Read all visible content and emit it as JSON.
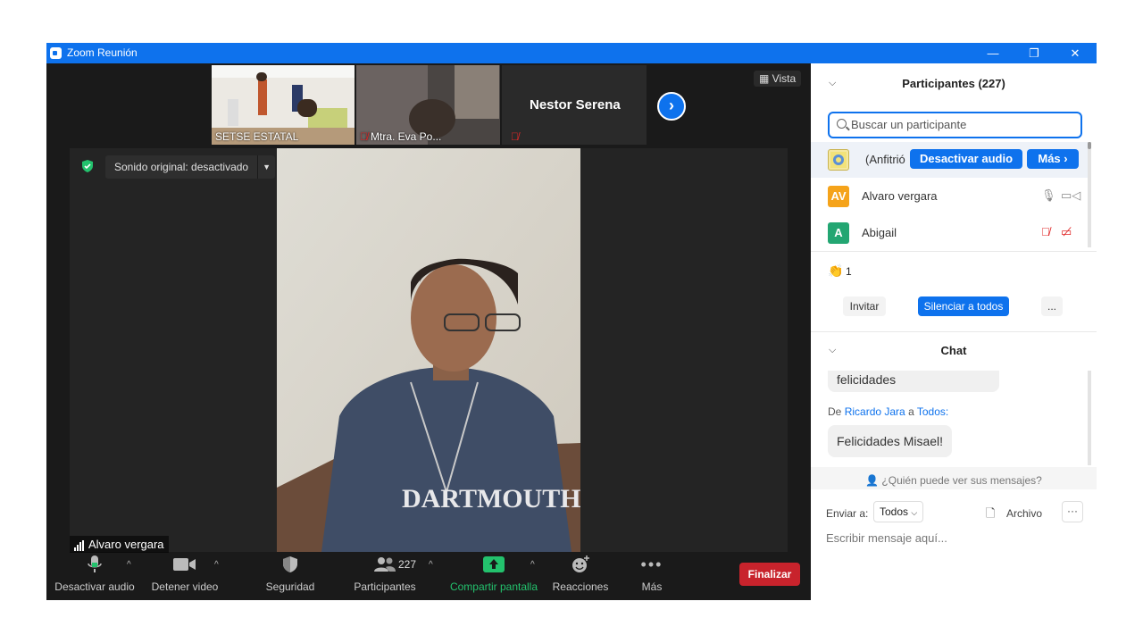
{
  "window": {
    "title": "Zoom Reunión",
    "controls": [
      "—",
      "❐",
      "✕"
    ]
  },
  "thumbnails": [
    {
      "name": "SETSE ESTATAL",
      "muted": false
    },
    {
      "name": "Mtra. Eva Po...",
      "muted": true
    },
    {
      "name": "",
      "muted": true
    },
    {
      "name": "Nestor Serena",
      "muted": false
    }
  ],
  "view_button": "Vista",
  "sound_option": "Sonido original: desactivado",
  "active_speaker": "Alvaro vergara",
  "toolbar": {
    "mute": "Desactivar audio",
    "stop_video": "Detener video",
    "security": "Seguridad",
    "participants": "Participantes",
    "participants_count": "227",
    "share": "Compartir pantalla",
    "reactions": "Reacciones",
    "more": "Más",
    "end": "Finalizar"
  },
  "panel": {
    "participants_title": "Participantes (227)",
    "search_placeholder": "Buscar un participante",
    "host_label": "(Anfitrió",
    "host_mute_btn": "Desactivar audio",
    "host_more_btn": "Más",
    "participants": [
      {
        "initials": "AV",
        "name": "Alvaro vergara",
        "color": "#f5a31a",
        "muted": false,
        "video_off": false
      },
      {
        "initials": "A",
        "name": "Abigail",
        "color": "#23a672",
        "muted": true,
        "video_off": true
      }
    ],
    "raised_hands": "1",
    "invite": "Invitar",
    "mute_all": "Silenciar a todos",
    "more_dots": "...",
    "chat_title": "Chat",
    "chat_prev_message": "felicidades",
    "chat_from_prefix": "De",
    "chat_sender": "Ricardo Jara",
    "chat_to_word": "a",
    "chat_recipient": "Todos:",
    "chat_message": "Felicidades Misael!",
    "who_can_see": "¿Quién puede ver sus mensajes?",
    "send_to_label": "Enviar a:",
    "send_to_value": "Todos",
    "file_label": "Archivo",
    "input_placeholder": "Escribir mensaje aquí..."
  }
}
